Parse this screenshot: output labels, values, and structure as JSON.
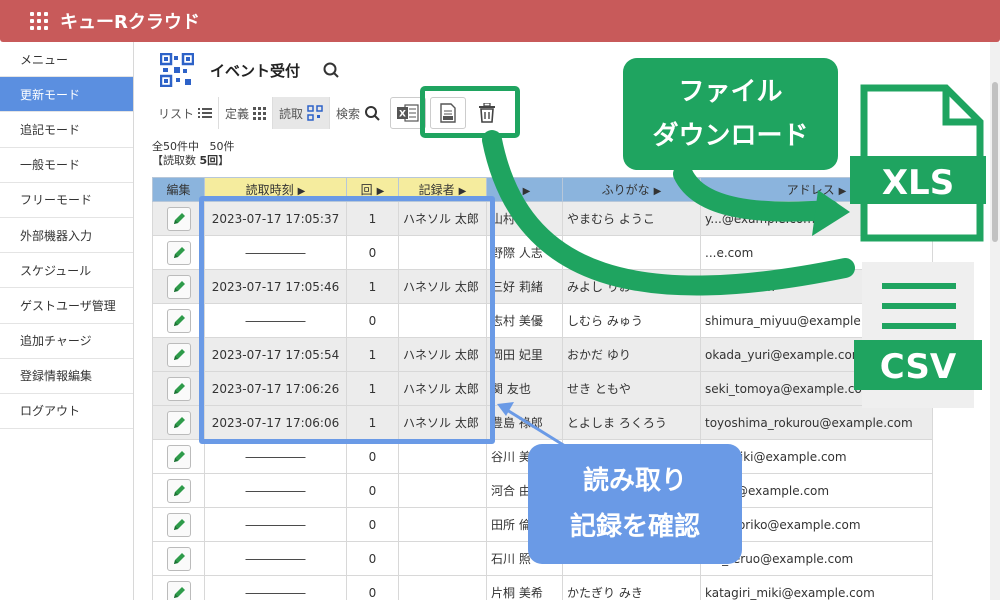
{
  "app": {
    "title": "キューRクラウド"
  },
  "sidebar": {
    "items": [
      {
        "label": "メニュー"
      },
      {
        "label": "更新モード"
      },
      {
        "label": "追記モード"
      },
      {
        "label": "一般モード"
      },
      {
        "label": "フリーモード"
      },
      {
        "label": "外部機器入力"
      },
      {
        "label": "スケジュール"
      },
      {
        "label": "ゲストユーザ管理"
      },
      {
        "label": "追加チャージ"
      },
      {
        "label": "登録情報編集"
      },
      {
        "label": "ログアウト"
      }
    ],
    "active_index": 1
  },
  "page": {
    "title": "イベント受付"
  },
  "toolbar": {
    "list": "リスト",
    "fixed": "定義",
    "read": "読取",
    "search": "検索"
  },
  "summary": {
    "total_label": "全50件中",
    "shown": "50件",
    "read_count_prefix": "【読取数 ",
    "read_count": "5回",
    "read_count_suffix": "】"
  },
  "table": {
    "headers": [
      "編集",
      "読取時刻",
      "回",
      "記録者",
      "",
      "ふりがな",
      "アドレス"
    ],
    "rows": [
      [
        "2023-07-17 17:05:37",
        "1",
        "ハネソル 太郎",
        "山村 陽",
        "やまむら ようこ",
        "y...@example.com"
      ],
      [
        "―――――",
        "0",
        "",
        "野際 人志",
        "",
        "...e.com"
      ],
      [
        "2023-07-17 17:05:46",
        "1",
        "ハネソル 太郎",
        "三好 莉緒",
        "みよし りお",
        "miyoshi...m"
      ],
      [
        "―――――",
        "0",
        "",
        "志村 美優",
        "しむら みゅう",
        "shimura_miyuu@example.com"
      ],
      [
        "2023-07-17 17:05:54",
        "1",
        "ハネソル 太郎",
        "岡田 妃里",
        "おかだ ゆり",
        "okada_yuri@example.com"
      ],
      [
        "2023-07-17 17:06:26",
        "1",
        "ハネソル 太郎",
        "関 友也",
        "せき ともや",
        "seki_tomoya@example.com"
      ],
      [
        "2023-07-17 17:06:06",
        "1",
        "ハネソル 太郎",
        "豊島 祿郎",
        "とよしま ろくろう",
        "toyoshima_rokurou@example.com"
      ],
      [
        "―――――",
        "0",
        "",
        "谷川 美",
        "",
        "wa_miki@example.com"
      ],
      [
        "―――――",
        "0",
        "",
        "河合 由",
        "",
        "_yuki@example.com"
      ],
      [
        "―――――",
        "0",
        "",
        "田所 倫",
        "",
        "oro_noriko@example.com"
      ],
      [
        "―――――",
        "0",
        "",
        "石川 照",
        "",
        "wa_teruo@example.com"
      ],
      [
        "―――――",
        "0",
        "",
        "片桐 美希",
        "かたぎり みき",
        "katagiri_miki@example.com"
      ]
    ]
  },
  "callouts": {
    "download": [
      "ファイル",
      "ダウンロード"
    ],
    "confirm": [
      "読み取り",
      "記録を確認"
    ]
  },
  "files": {
    "xls": "XLS",
    "csv": "CSV"
  },
  "colors": {
    "header": "#c85a5a",
    "active": "#5b8fe0",
    "green": "#1fa460",
    "blue": "#6a9ae6"
  }
}
